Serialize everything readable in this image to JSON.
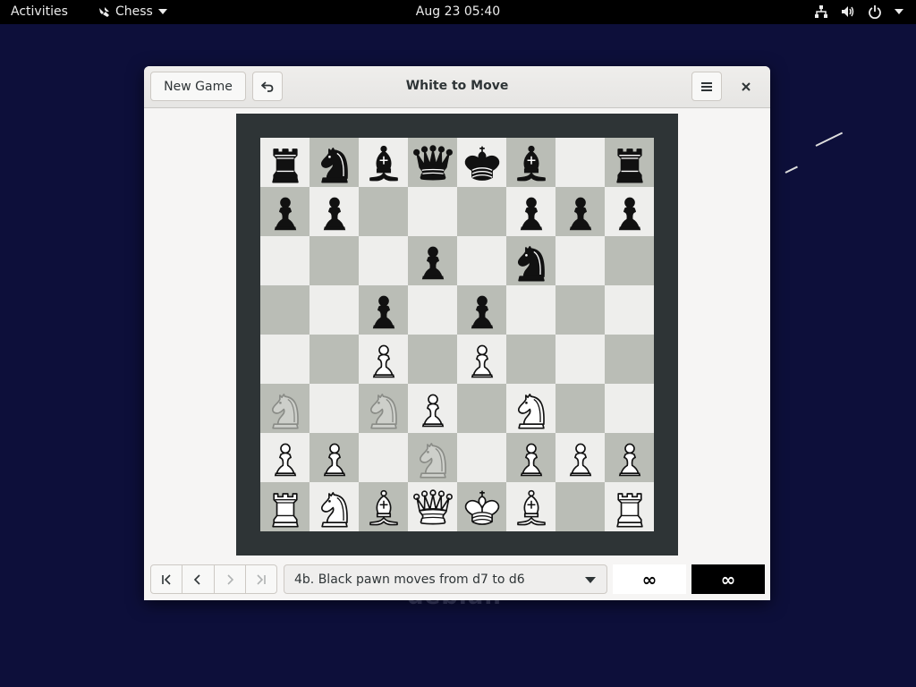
{
  "topbar": {
    "activities": "Activities",
    "app_name": "Chess",
    "clock": "Aug 23  05:40"
  },
  "window": {
    "title": "White to Move",
    "new_game_label": "New Game"
  },
  "board": {
    "light_color": "#eeeeec",
    "dark_color": "#babdb6",
    "frame_color": "#2e3436",
    "ranks": [
      [
        "br",
        "bn",
        "bb",
        "bq",
        "bk",
        "bb",
        "",
        "br"
      ],
      [
        "bp",
        "bp",
        "",
        "",
        "",
        "bp",
        "bp",
        "bp"
      ],
      [
        "",
        "",
        "",
        "bp",
        "",
        "bn",
        "",
        ""
      ],
      [
        "",
        "",
        "bp",
        "",
        "bp",
        "",
        "",
        ""
      ],
      [
        "",
        "",
        "wp",
        "",
        "wp",
        "",
        "",
        ""
      ],
      [
        "gn",
        "",
        "gn",
        "wp",
        "",
        "wn",
        "",
        ""
      ],
      [
        "wp",
        "wp",
        "",
        "gn",
        "",
        "wp",
        "wp",
        "wp"
      ],
      [
        "wr",
        "wn",
        "wb",
        "wq",
        "wk",
        "wb",
        "",
        "wr"
      ]
    ]
  },
  "history": {
    "current_move": "4b. Black pawn moves from d7 to d6"
  },
  "clocks": {
    "white": "∞",
    "black": "∞"
  },
  "icons": {
    "undo": "undo-icon",
    "menu": "hamburger-menu-icon",
    "close": "close-icon",
    "first": "go-first-icon",
    "previous": "go-previous-icon",
    "next": "go-next-icon",
    "last": "go-last-icon"
  }
}
